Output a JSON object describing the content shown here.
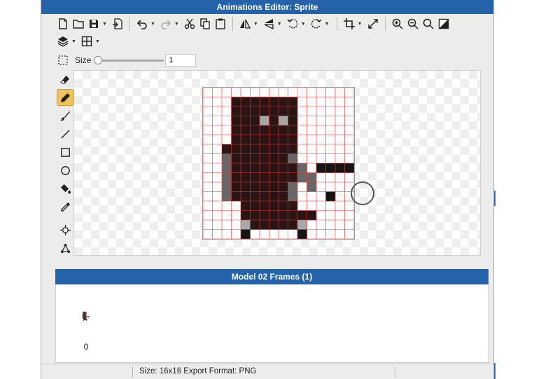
{
  "window": {
    "title": "Animations Editor: Sprite"
  },
  "toolbar": {
    "row1": [
      "new-file-icon",
      "open-folder-icon",
      "save-icon",
      "export-icon",
      "undo-icon",
      "redo-icon",
      "cut-icon",
      "copy-icon",
      "paste-icon",
      "flip-horizontal-icon",
      "flip-vertical-icon",
      "rotate-left-icon",
      "rotate-right-icon",
      "crop-icon",
      "resize-icon",
      "zoom-in-icon",
      "zoom-out-icon",
      "zoom-fit-icon",
      "background-toggle-icon"
    ],
    "row2": [
      "layers-icon",
      "grid-icon"
    ],
    "size_label": "Size",
    "size_value": "1",
    "size_slider_fraction": 0.0
  },
  "tools": [
    {
      "name": "eraser-icon",
      "active": false
    },
    {
      "name": "pencil-icon",
      "active": true
    },
    {
      "name": "brush-icon",
      "active": false
    },
    {
      "name": "line-icon",
      "active": false
    },
    {
      "name": "rectangle-icon",
      "active": false
    },
    {
      "name": "ellipse-icon",
      "active": false
    },
    {
      "name": "fill-bucket-icon",
      "active": false
    },
    {
      "name": "eyedropper-icon",
      "active": false
    },
    {
      "name": "move-point-icon",
      "active": false
    },
    {
      "name": "node-graph-icon",
      "active": false
    }
  ],
  "sprite": {
    "grid_size": 16,
    "palette": {
      "1": "#2a1414",
      "2": "#151515",
      "3": "#676767",
      "4": "#a7a7a7"
    },
    "pixels": [
      "................",
      "...1111111......",
      "...1111111......",
      "...1114141......",
      "...1111111......",
      "...1111111......",
      "..11111111......",
      "..31111113......",
      "..311111113.2222",
      "..3111111133....",
      "..31111113.3....",
      "..31111113...2..",
      "....111111......",
      "....11111111....",
      "....4111114.....",
      "....2.....2....."
    ]
  },
  "frames": {
    "title": "Model 02 Frames (1)",
    "items": [
      {
        "index": "0"
      }
    ]
  },
  "status": {
    "text": "Size: 16x16   Export Format: PNG"
  },
  "colors": {
    "accent": "#2463aa",
    "active_tool": "#f2c45a",
    "grid_line": "#e23a3a"
  }
}
